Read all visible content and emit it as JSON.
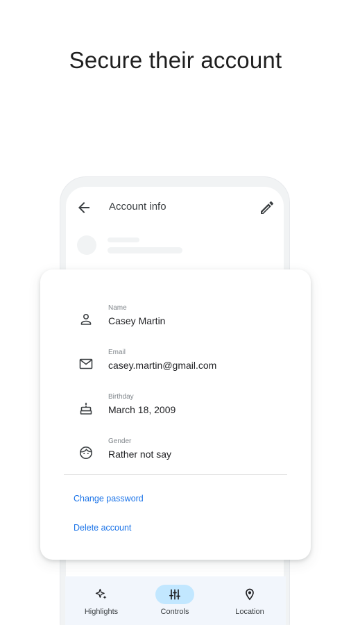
{
  "headline": "Secure their account",
  "appbar": {
    "title": "Account info",
    "back_icon": "arrow-back-icon",
    "edit_icon": "pencil-icon"
  },
  "fields": [
    {
      "label": "Name",
      "value": "Casey Martin",
      "icon": "person-icon"
    },
    {
      "label": "Email",
      "value": "casey.martin@gmail.com",
      "icon": "mail-icon"
    },
    {
      "label": "Birthday",
      "value": "March 18, 2009",
      "icon": "cake-icon"
    },
    {
      "label": "Gender",
      "value": "Rather not say",
      "icon": "face-icon"
    }
  ],
  "actions": {
    "change_password": "Change password",
    "delete_account": "Delete account"
  },
  "bottom_nav": {
    "items": [
      {
        "label": "Highlights",
        "icon": "sparkle-icon",
        "active": false
      },
      {
        "label": "Controls",
        "icon": "tune-icon",
        "active": true
      },
      {
        "label": "Location",
        "icon": "location-pin-icon",
        "active": false
      }
    ]
  },
  "colors": {
    "link": "#1a73e8",
    "active_nav_pill": "#c2e7ff",
    "nav_background": "#f2f6fc"
  }
}
